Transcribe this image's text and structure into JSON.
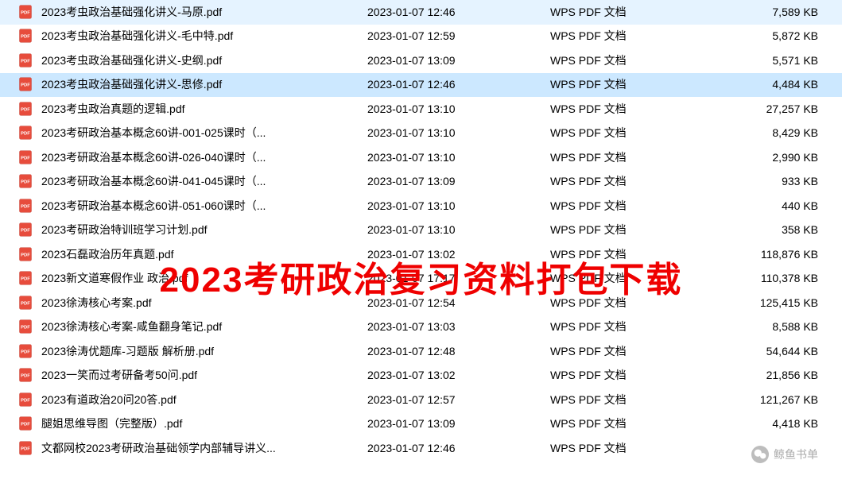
{
  "overlay": "2023考研政治复习资料打包下载",
  "watermark": "鲸鱼书单",
  "fileType": "WPS PDF 文档",
  "files": [
    {
      "name": "2023考虫政治基础强化讲义-马原.pdf",
      "date": "2023-01-07 12:46",
      "size": "7,589 KB",
      "selected": false
    },
    {
      "name": "2023考虫政治基础强化讲义-毛中特.pdf",
      "date": "2023-01-07 12:59",
      "size": "5,872 KB",
      "selected": false
    },
    {
      "name": "2023考虫政治基础强化讲义-史纲.pdf",
      "date": "2023-01-07 13:09",
      "size": "5,571 KB",
      "selected": false
    },
    {
      "name": "2023考虫政治基础强化讲义-思修.pdf",
      "date": "2023-01-07 12:46",
      "size": "4,484 KB",
      "selected": true
    },
    {
      "name": "2023考虫政治真题的逻辑.pdf",
      "date": "2023-01-07 13:10",
      "size": "27,257 KB",
      "selected": false
    },
    {
      "name": "2023考研政治基本概念60讲-001-025课时（...",
      "date": "2023-01-07 13:10",
      "size": "8,429 KB",
      "selected": false
    },
    {
      "name": "2023考研政治基本概念60讲-026-040课时（...",
      "date": "2023-01-07 13:10",
      "size": "2,990 KB",
      "selected": false
    },
    {
      "name": "2023考研政治基本概念60讲-041-045课时（...",
      "date": "2023-01-07 13:09",
      "size": "933 KB",
      "selected": false
    },
    {
      "name": "2023考研政治基本概念60讲-051-060课时（...",
      "date": "2023-01-07 13:10",
      "size": "440 KB",
      "selected": false
    },
    {
      "name": "2023考研政治特训班学习计划.pdf",
      "date": "2023-01-07 13:10",
      "size": "358 KB",
      "selected": false
    },
    {
      "name": "2023石磊政治历年真题.pdf",
      "date": "2023-01-07 13:02",
      "size": "118,876 KB",
      "selected": false
    },
    {
      "name": "2023新文道寒假作业 政治.pdf",
      "date": "2023-01-07 17:17",
      "size": "110,378 KB",
      "selected": false
    },
    {
      "name": "2023徐涛核心考案.pdf",
      "date": "2023-01-07 12:54",
      "size": "125,415 KB",
      "selected": false
    },
    {
      "name": "2023徐涛核心考案-咸鱼翻身笔记.pdf",
      "date": "2023-01-07 13:03",
      "size": "8,588 KB",
      "selected": false
    },
    {
      "name": "2023徐涛优题库-习题版 解析册.pdf",
      "date": "2023-01-07 12:48",
      "size": "54,644 KB",
      "selected": false
    },
    {
      "name": "2023一笑而过考研备考50问.pdf",
      "date": "2023-01-07 13:02",
      "size": "21,856 KB",
      "selected": false
    },
    {
      "name": "2023有道政治20问20答.pdf",
      "date": "2023-01-07 12:57",
      "size": "121,267 KB",
      "selected": false
    },
    {
      "name": "腿姐思维导图（完整版）.pdf",
      "date": "2023-01-07 13:09",
      "size": "4,418 KB",
      "selected": false
    },
    {
      "name": "文都网校2023考研政治基础领学内部辅导讲义...",
      "date": "2023-01-07 12:46",
      "size": "",
      "selected": false
    }
  ]
}
